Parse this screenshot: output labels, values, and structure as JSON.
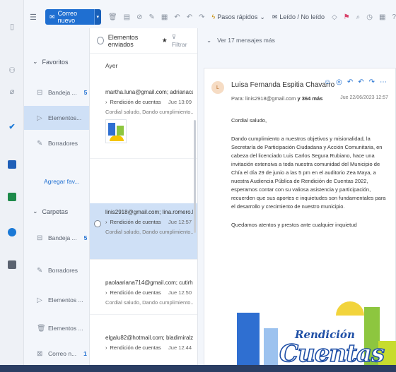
{
  "toolbar": {
    "new_mail": "Correo nuevo",
    "quick_steps": "Pasos rápidos",
    "read_unread": "Leído / No leído"
  },
  "folders": {
    "favorites_header": "Favoritos",
    "fav_items": [
      {
        "label": "Bandeja ...",
        "count": "5"
      },
      {
        "label": "Elementos..."
      },
      {
        "label": "Borradores"
      }
    ],
    "add_favorite": "Agregar fav...",
    "folders_header": "Carpetas",
    "folder_items": [
      {
        "label": "Bandeja ...",
        "count": "5"
      },
      {
        "label": "Borradores"
      },
      {
        "label": "Elementos ..."
      },
      {
        "label": "Elementos ..."
      },
      {
        "label": "Correo n...",
        "count": "1"
      }
    ]
  },
  "list": {
    "title": "Elementos enviados",
    "filter": "Filtrar",
    "group": "Ayer",
    "messages": [
      {
        "from": "martha.luna@gmail.com; adrianacas...",
        "subject": "Rendición de cuentas",
        "time": "Jue 13:09",
        "preview": "Cordial saludo, Dando cumplimiento..."
      },
      {
        "from": "linis2918@gmail.com; lina.romero.b...",
        "subject": "Rendición de cuentas",
        "time": "Jue 12:57",
        "preview": "Cordial saludo, Dando cumplimiento..."
      },
      {
        "from": "paolaariana714@gmail.com; cutirho...",
        "subject": "Rendición de cuentas",
        "time": "Jue 12:50",
        "preview": "Cordial saludo, Dando cumplimiento..."
      },
      {
        "from": "elgalu82@hotmail.com; bladimiralza...",
        "subject": "Rendición de cuentas",
        "time": "Jue 12:44",
        "preview": ""
      }
    ]
  },
  "reading": {
    "conversation": "Ver 17 mensajes más",
    "sender": "Luisa Fernanda Espitia Chavarro",
    "avatar": "L",
    "to_prefix": "Para:",
    "to": "linis2918@gmail.com",
    "to_more": "y 364 más",
    "date": "Jue 22/06/2023 12:57",
    "greeting": "Cordial saludo,",
    "paragraph": "Dando cumplimiento a nuestros objetivos y misionalidad, la Secretaría de Participación Ciudadana y Acción Comunitaria, en cabeza del licenciado Luis Carlos Segura Rubiano, hace una invitación extensiva a toda nuestra comunidad del Municipio de Chía el día 29 de junio a las 5 pm en el auditorio Zea Maya, a nuestra Audiencia Pública de Rendición de Cuentas 2022, esperamos contar con su valiosa asistencia y participación, recuerden que sus aportes e inquietudes son fundamentales para el desarrollo y crecimiento de nuestro municipio.",
    "closing": "Quedamos atentos y prestos ante cualquier inquietud",
    "banner_line1": "Rendición",
    "banner_line2": "Cuentas"
  }
}
